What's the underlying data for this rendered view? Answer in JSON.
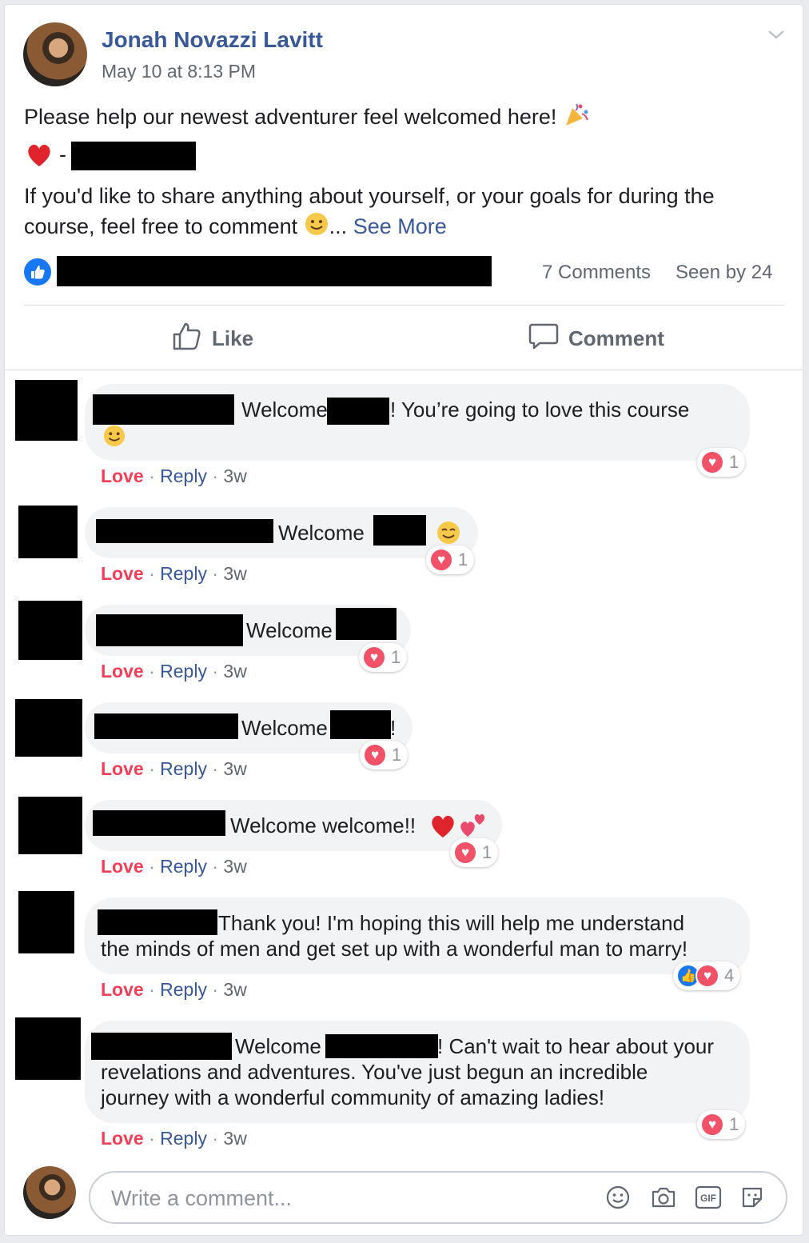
{
  "post": {
    "author": "Jonah Novazzi Lavitt",
    "timestamp": "May 10 at 8:13 PM",
    "text_line1": "Please help our newest adventurer feel welcomed here!",
    "heart_dash": "-",
    "text_line2": "If you'd like to share anything about yourself, or your goals for during the",
    "text_line3": "course, feel free to comment",
    "ellipsis": "...",
    "see_more": "See More",
    "comments_count": "7 Comments",
    "seen_by": "Seen by 24"
  },
  "actions": {
    "like": "Like",
    "comment": "Comment"
  },
  "link_labels": {
    "love": "Love",
    "reply": "Reply",
    "sep": "·",
    "age": "3w"
  },
  "comments": [
    {
      "text": "Welcome",
      "text_tail": "! You’re going to love this course",
      "reactions": "1"
    },
    {
      "text": "Welcome",
      "reactions": "1"
    },
    {
      "text": "Welcome",
      "reactions": "1"
    },
    {
      "text": "Welcome",
      "text_tail": "!",
      "reactions": "1"
    },
    {
      "text": "Welcome welcome!!",
      "reactions": "1"
    },
    {
      "text": "Thank you! I'm hoping this will help me understand",
      "text_line2": "the minds of men and get set up with a wonderful man to marry!",
      "reactions": "4"
    },
    {
      "text": "Welcome",
      "text_tail": "! Can't wait to hear about your",
      "text_line2": "revelations and adventures. You've just begun an incredible",
      "text_line3": "journey with a wonderful community of amazing ladies!",
      "reactions": "1"
    }
  ],
  "composer": {
    "placeholder": "Write a comment...",
    "gif_label": "GIF"
  },
  "colors": {
    "link": "#385898",
    "love": "#f33e58",
    "like_badge": "#1877f2",
    "heart": "#f25268"
  },
  "icons": [
    "chevron-down-icon",
    "like-icon",
    "comment-icon",
    "heart-icon",
    "party-popper-icon",
    "smile-icon",
    "camera-icon",
    "gif-icon",
    "sticker-icon"
  ]
}
